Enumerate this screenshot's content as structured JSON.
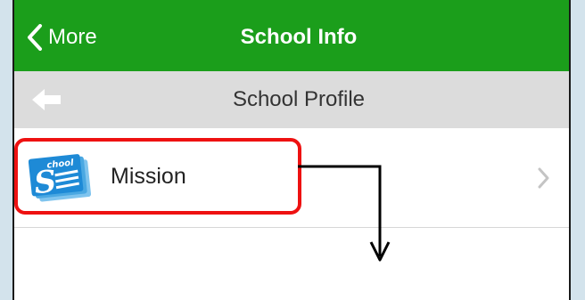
{
  "navbar": {
    "back_label": "More",
    "title": "School Info",
    "background_color": "#1b9e1b"
  },
  "subheader": {
    "back_icon": "arrow-left-icon",
    "title": "School Profile"
  },
  "list": {
    "items": [
      {
        "icon": "school-document-icon",
        "icon_text": "School",
        "label": "Mission",
        "trailing_icon": "chevron-right-icon"
      }
    ]
  },
  "annotation": {
    "highlight_color": "#ee1111",
    "arrow_color": "#000000"
  }
}
